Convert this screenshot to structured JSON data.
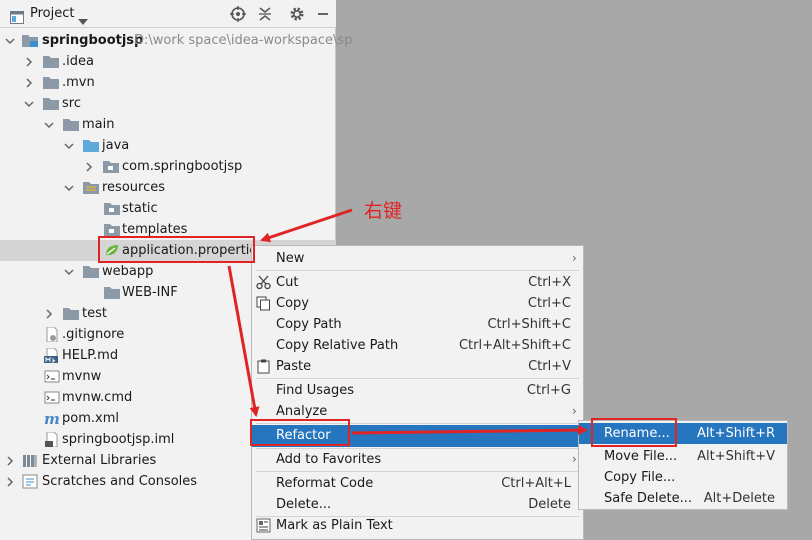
{
  "panel": {
    "title": "Project"
  },
  "tree": [
    {
      "label": "springbootjsp",
      "hint": "D:\\work space\\idea-workspace\\sp",
      "bold": true
    },
    {
      "label": ".idea"
    },
    {
      "label": ".mvn"
    },
    {
      "label": "src"
    },
    {
      "label": "main"
    },
    {
      "label": "java"
    },
    {
      "label": "com.springbootjsp"
    },
    {
      "label": "resources"
    },
    {
      "label": "static"
    },
    {
      "label": "templates"
    },
    {
      "label": "application.properties"
    },
    {
      "label": "webapp"
    },
    {
      "label": "WEB-INF"
    },
    {
      "label": "test"
    },
    {
      "label": ".gitignore"
    },
    {
      "label": "HELP.md"
    },
    {
      "label": "mvnw"
    },
    {
      "label": "mvnw.cmd"
    },
    {
      "label": "pom.xml"
    },
    {
      "label": "springbootjsp.iml"
    },
    {
      "label": "External Libraries"
    },
    {
      "label": "Scratches and Consoles"
    }
  ],
  "context_menu": {
    "items": [
      {
        "label": "New",
        "shortcut": ""
      },
      {
        "label": "Cut",
        "shortcut": "Ctrl+X"
      },
      {
        "label": "Copy",
        "shortcut": "Ctrl+C"
      },
      {
        "label": "Copy Path",
        "shortcut": "Ctrl+Shift+C"
      },
      {
        "label": "Copy Relative Path",
        "shortcut": "Ctrl+Alt+Shift+C"
      },
      {
        "label": "Paste",
        "shortcut": "Ctrl+V"
      },
      {
        "label": "Find Usages",
        "shortcut": "Ctrl+G"
      },
      {
        "label": "Analyze",
        "shortcut": ""
      },
      {
        "label": "Refactor",
        "shortcut": ""
      },
      {
        "label": "Add to Favorites",
        "shortcut": ""
      },
      {
        "label": "Reformat Code",
        "shortcut": "Ctrl+Alt+L"
      },
      {
        "label": "Delete...",
        "shortcut": "Delete"
      },
      {
        "label": "Mark as Plain Text",
        "shortcut": ""
      }
    ]
  },
  "refactor_menu": {
    "items": [
      {
        "label": "Rename...",
        "shortcut": "Alt+Shift+R"
      },
      {
        "label": "Move File...",
        "shortcut": "Alt+Shift+V"
      },
      {
        "label": "Copy File...",
        "shortcut": ""
      },
      {
        "label": "Safe Delete...",
        "shortcut": "Alt+Delete"
      }
    ]
  },
  "annotation": {
    "text": "右键"
  },
  "colors": {
    "highlight": "#2675bf",
    "annotation": "#e02424",
    "folder": "#8c99a6",
    "source_folder": "#5ea8dc"
  }
}
